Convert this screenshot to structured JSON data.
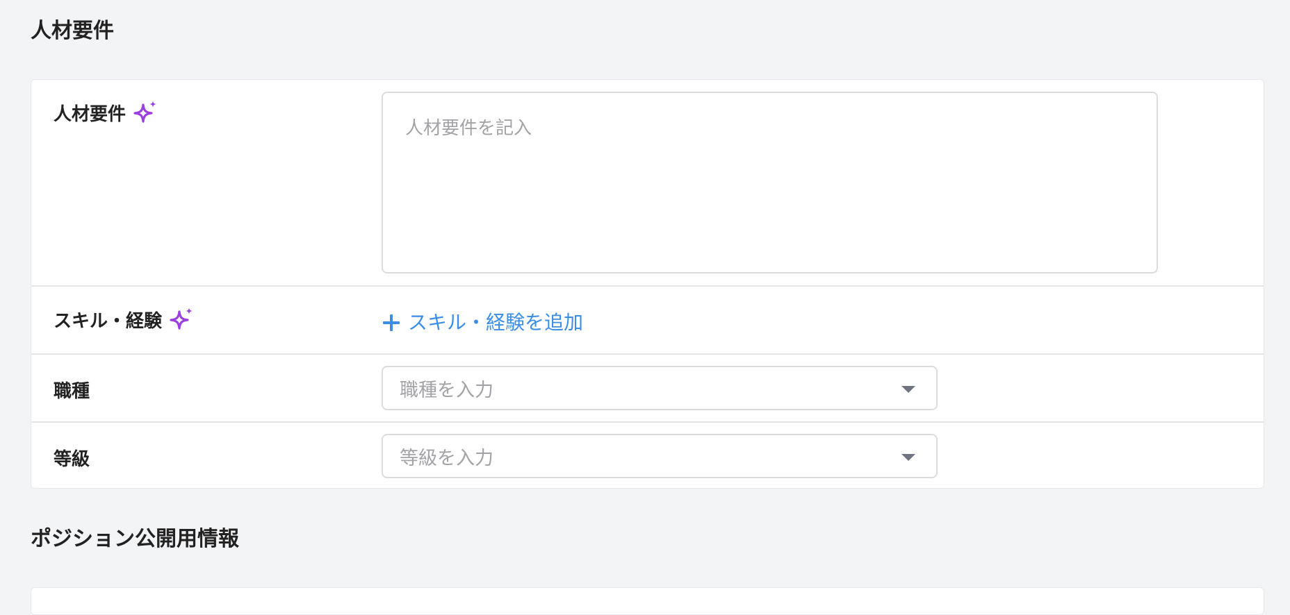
{
  "sections": {
    "requirements_title": "人材要件",
    "position_public_title": "ポジション公開用情報"
  },
  "fields": {
    "requirements": {
      "label": "人材要件",
      "placeholder": "人材要件を記入",
      "value": ""
    },
    "skills": {
      "label": "スキル・経験",
      "add_label": "スキル・経験を追加"
    },
    "job_type": {
      "label": "職種",
      "placeholder": "職種を入力"
    },
    "grade": {
      "label": "等級",
      "placeholder": "等級を入力"
    }
  },
  "icons": {
    "sparkle": "sparkle-icon",
    "plus": "plus-icon",
    "dropdown": "caret-down-icon"
  },
  "colors": {
    "accent": "#3b8ee8",
    "ai_sparkle": "#9b3fe0",
    "background": "#f3f4f6"
  }
}
